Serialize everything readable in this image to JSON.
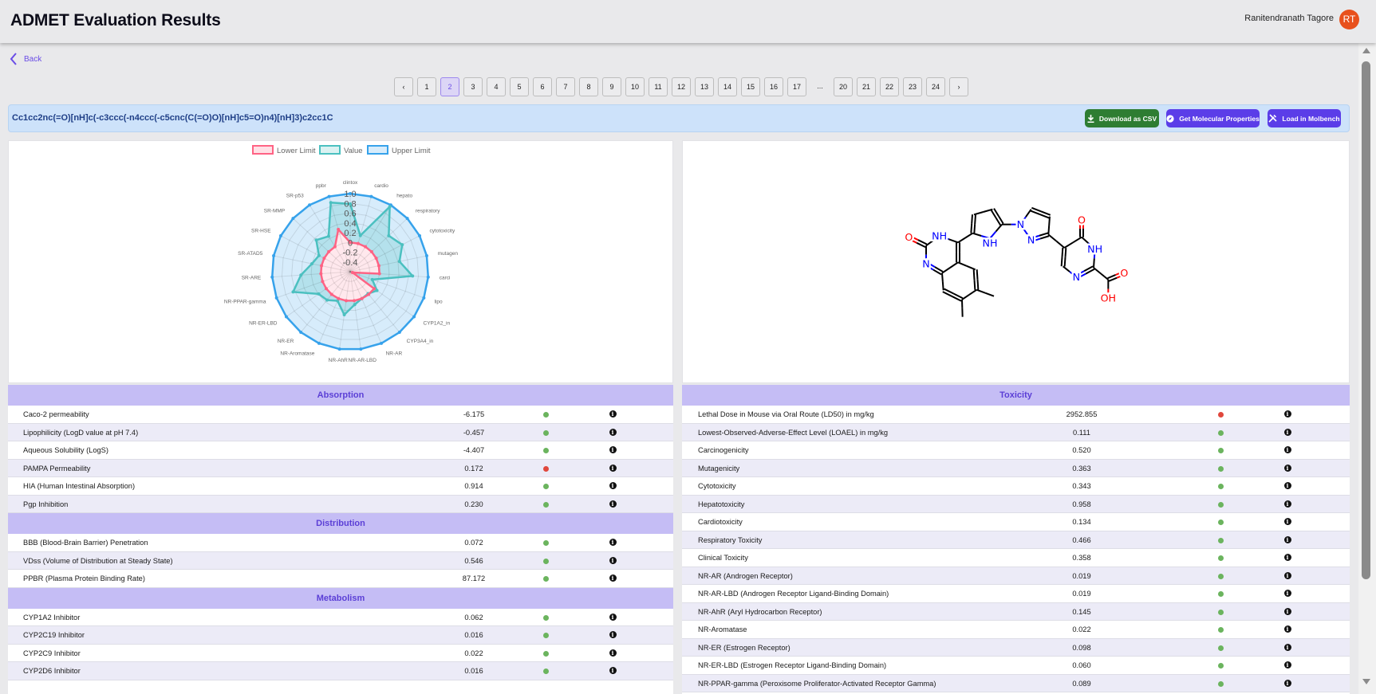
{
  "header": {
    "title": "ADMET Evaluation Results",
    "user_name": "Ranitendranath Tagore",
    "avatar_initials": "RT",
    "avatar_color": "#e8501c"
  },
  "nav": {
    "back_label": "Back"
  },
  "pagination": {
    "prev": "‹",
    "next": "›",
    "pages": [
      "1",
      "2",
      "3",
      "4",
      "5",
      "6",
      "7",
      "8",
      "9",
      "10",
      "11",
      "12",
      "13",
      "14",
      "15",
      "16",
      "17",
      "...",
      "20",
      "21",
      "22",
      "23",
      "24"
    ],
    "current": "2"
  },
  "smiles": "Cc1cc2nc(=O)[nH]c(-c3ccc(-n4ccc(-c5cnc(C(=O)O)[nH]c5=O)n4)[nH]3)c2cc1C",
  "actions": {
    "download_csv": "Download as CSV",
    "get_properties": "Get Molecular Properties",
    "load_molbench": "Load in Molbench",
    "download_color": "#2e7d32",
    "primary_color": "#5b3de8"
  },
  "chart_data": {
    "type": "radar",
    "legend": [
      "Lower Limit",
      "Value",
      "Upper Limit"
    ],
    "legend_position": "top",
    "colors": {
      "lower": "#ff6384",
      "value": "#4bc0c0",
      "upper": "#36a2eb"
    },
    "axes": [
      "clintox",
      "cardio",
      "hepato",
      "respiratory",
      "cytotoxicity",
      "mutagen",
      "carci",
      "lipo",
      "CYP1A2_in",
      "CYP3A4_in",
      "NR-AR",
      "NR-AR-LBD",
      "NR-AhR",
      "NR-Aromatase",
      "NR-ER",
      "NR-ER-LBD",
      "NR-PPAR-gamma",
      "SR-ARE",
      "SR-ATAD5",
      "SR-HSE",
      "SR-MMP",
      "SR-p53",
      "ppbr"
    ],
    "r_range": [
      -0.6,
      1.0
    ],
    "ticks": [
      "1.0",
      "0.8",
      "0.6",
      "0.4",
      "0.2",
      "0",
      "-0.2",
      "-0.4"
    ],
    "series": [
      {
        "name": "Lower Limit",
        "values": [
          0,
          0,
          0,
          0,
          0,
          0,
          0,
          -0.55,
          0,
          0,
          0,
          0,
          0,
          0,
          0,
          0,
          0,
          0,
          0,
          0,
          0,
          0,
          0.3
        ]
      },
      {
        "name": "Value",
        "values": [
          0.79,
          0.17,
          0.96,
          0.48,
          0.6,
          0.43,
          0.68,
          -0.12,
          0.07,
          -0.02,
          0.0,
          0.08,
          0.29,
          0.05,
          0.15,
          0.19,
          0.64,
          0.41,
          0.2,
          0.12,
          0.35,
          0.25,
          0.87
        ]
      },
      {
        "name": "Upper Limit",
        "values": [
          1,
          1,
          1,
          1,
          1,
          1,
          1,
          1,
          1,
          1,
          1,
          1,
          1,
          1,
          1,
          1,
          1,
          1,
          1,
          1,
          1,
          1,
          1
        ]
      }
    ],
    "grid": true
  },
  "molecule": {
    "atom_labels": [
      "O",
      "NH",
      "N",
      "NH",
      "N",
      "N",
      "O",
      "NH",
      "N",
      "O",
      "OH"
    ]
  },
  "status_colors": {
    "ok": "#6bb45e",
    "bad": "#e0473c"
  },
  "left_table": {
    "sections": [
      {
        "title": "Absorption",
        "rows": [
          {
            "name": "Caco-2 permeability",
            "value": "-6.175",
            "status": "ok"
          },
          {
            "name": "Lipophilicity (LogD value at pH 7.4)",
            "value": "-0.457",
            "status": "ok"
          },
          {
            "name": "Aqueous Solubility (LogS)",
            "value": "-4.407",
            "status": "ok"
          },
          {
            "name": "PAMPA Permeability",
            "value": "0.172",
            "status": "bad"
          },
          {
            "name": "HIA (Human Intestinal Absorption)",
            "value": "0.914",
            "status": "ok"
          },
          {
            "name": "Pgp Inhibition",
            "value": "0.230",
            "status": "ok"
          }
        ]
      },
      {
        "title": "Distribution",
        "rows": [
          {
            "name": "BBB (Blood-Brain Barrier) Penetration",
            "value": "0.072",
            "status": "ok"
          },
          {
            "name": "VDss (Volume of Distribution at Steady State)",
            "value": "0.546",
            "status": "ok"
          },
          {
            "name": "PPBR (Plasma Protein Binding Rate)",
            "value": "87.172",
            "status": "ok"
          }
        ]
      },
      {
        "title": "Metabolism",
        "rows": [
          {
            "name": "CYP1A2 Inhibitor",
            "value": "0.062",
            "status": "ok"
          },
          {
            "name": "CYP2C19 Inhibitor",
            "value": "0.016",
            "status": "ok"
          },
          {
            "name": "CYP2C9 Inhibitor",
            "value": "0.022",
            "status": "ok"
          },
          {
            "name": "CYP2D6 Inhibitor",
            "value": "0.016",
            "status": "ok"
          }
        ]
      }
    ]
  },
  "right_table": {
    "sections": [
      {
        "title": "Toxicity",
        "rows": [
          {
            "name": "Lethal Dose in Mouse via Oral Route (LD50) in mg/kg",
            "value": "2952.855",
            "status": "bad"
          },
          {
            "name": "Lowest-Observed-Adverse-Effect Level (LOAEL) in mg/kg",
            "value": "0.111",
            "status": "ok"
          },
          {
            "name": "Carcinogenicity",
            "value": "0.520",
            "status": "ok"
          },
          {
            "name": "Mutagenicity",
            "value": "0.363",
            "status": "ok"
          },
          {
            "name": "Cytotoxicity",
            "value": "0.343",
            "status": "ok"
          },
          {
            "name": "Hepatotoxicity",
            "value": "0.958",
            "status": "ok"
          },
          {
            "name": "Cardiotoxicity",
            "value": "0.134",
            "status": "ok"
          },
          {
            "name": "Respiratory Toxicity",
            "value": "0.466",
            "status": "ok"
          },
          {
            "name": "Clinical Toxicity",
            "value": "0.358",
            "status": "ok"
          },
          {
            "name": "NR-AR (Androgen Receptor)",
            "value": "0.019",
            "status": "ok"
          },
          {
            "name": "NR-AR-LBD (Androgen Receptor Ligand-Binding Domain)",
            "value": "0.019",
            "status": "ok"
          },
          {
            "name": "NR-AhR (Aryl Hydrocarbon Receptor)",
            "value": "0.145",
            "status": "ok"
          },
          {
            "name": "NR-Aromatase",
            "value": "0.022",
            "status": "ok"
          },
          {
            "name": "NR-ER (Estrogen Receptor)",
            "value": "0.098",
            "status": "ok"
          },
          {
            "name": "NR-ER-LBD (Estrogen Receptor Ligand-Binding Domain)",
            "value": "0.060",
            "status": "ok"
          },
          {
            "name": "NR-PPAR-gamma (Peroxisome Proliferator-Activated Receptor Gamma)",
            "value": "0.089",
            "status": "ok"
          }
        ]
      }
    ]
  },
  "info_icon": "i"
}
